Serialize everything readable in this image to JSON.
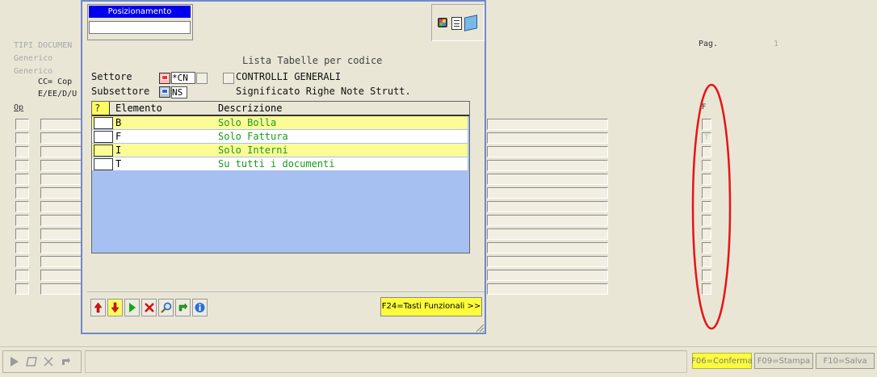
{
  "background": {
    "header_lines": [
      "TIPI DOCUMEN",
      "Generico",
      "Generico"
    ],
    "cc_line": "CC= Cop",
    "e_line": "E/EE/D/U",
    "op_label": "Op",
    "pag_label": "Pag.",
    "pag_value": "1",
    "f_column_label": "F",
    "f_second_value": "T"
  },
  "dialog": {
    "search_label": "Posizionamento",
    "search_value": "",
    "title": "Lista Tabelle per codice",
    "settore_label": "Settore",
    "settore_value": "*CN",
    "settore_desc": "CONTROLLI GENERALI",
    "subsettore_label": "Subsettore",
    "subsettore_value": "NS",
    "subsettore_desc": "Significato Righe Note Strutt.",
    "table": {
      "header_flag": "?",
      "header_code": "Elemento",
      "header_desc": "Descrizione",
      "rows": [
        {
          "code": "B",
          "desc": "Solo Bolla"
        },
        {
          "code": "F",
          "desc": "Solo Fattura"
        },
        {
          "code": "I",
          "desc": "Solo Interni"
        },
        {
          "code": "T",
          "desc": "Su tutti i documenti"
        }
      ]
    },
    "f24_label": "F24=Tasti Funzionali >>"
  },
  "bottom_bar": {
    "f06_label": "F06=Conferma",
    "f09_label": "F09=Stampa",
    "f10_label": "F10=Salva"
  },
  "colors": {
    "highlight_yellow": "#fcfc96",
    "list_blue": "#a7c0f2",
    "title_blue": "#0000ee",
    "desc_green": "#1a9a1a",
    "annotation_red": "#e51515"
  }
}
